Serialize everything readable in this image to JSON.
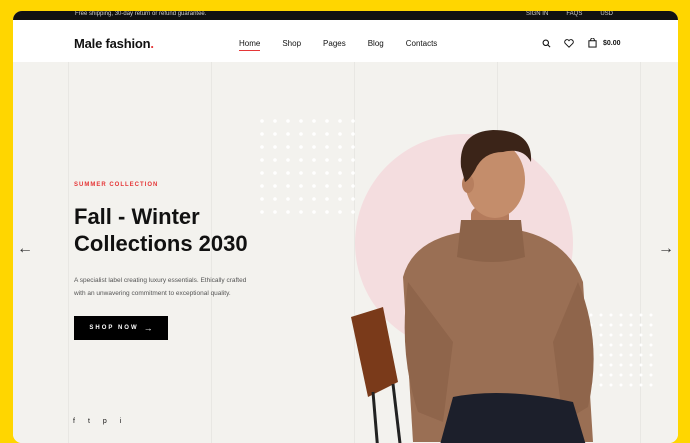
{
  "topbar": {
    "text": "Free shipping, 30-day return or refund guarantee.",
    "signin": "SIGN IN",
    "faqs": "FAQS",
    "currency": "USD"
  },
  "logo": {
    "text": "Male fashion",
    "dot": "."
  },
  "nav": [
    {
      "label": "Home"
    },
    {
      "label": "Shop"
    },
    {
      "label": "Pages"
    },
    {
      "label": "Blog"
    },
    {
      "label": "Contacts"
    }
  ],
  "header_icons": {
    "search": "search-icon",
    "heart": "heart-icon",
    "cart": "bag-icon",
    "cart_price": "$0.00"
  },
  "hero": {
    "subtitle": "SUMMER COLLECTION",
    "title_line1": "Fall - Winter",
    "title_line2": "Collections 2030",
    "desc_line1": "A specialist label creating luxury essentials. Ethically crafted",
    "desc_line2": "with an unwavering commitment to exceptional quality.",
    "button": "SHOP NOW",
    "button_arrow": "→",
    "prev": "←",
    "next": "→"
  },
  "socials": [
    "f",
    "t",
    "p",
    "i"
  ],
  "colors": {
    "accent": "#e53637",
    "frame": "#ffd600",
    "hero_bg": "#f3f2ee",
    "circle": "#f4dddf"
  }
}
